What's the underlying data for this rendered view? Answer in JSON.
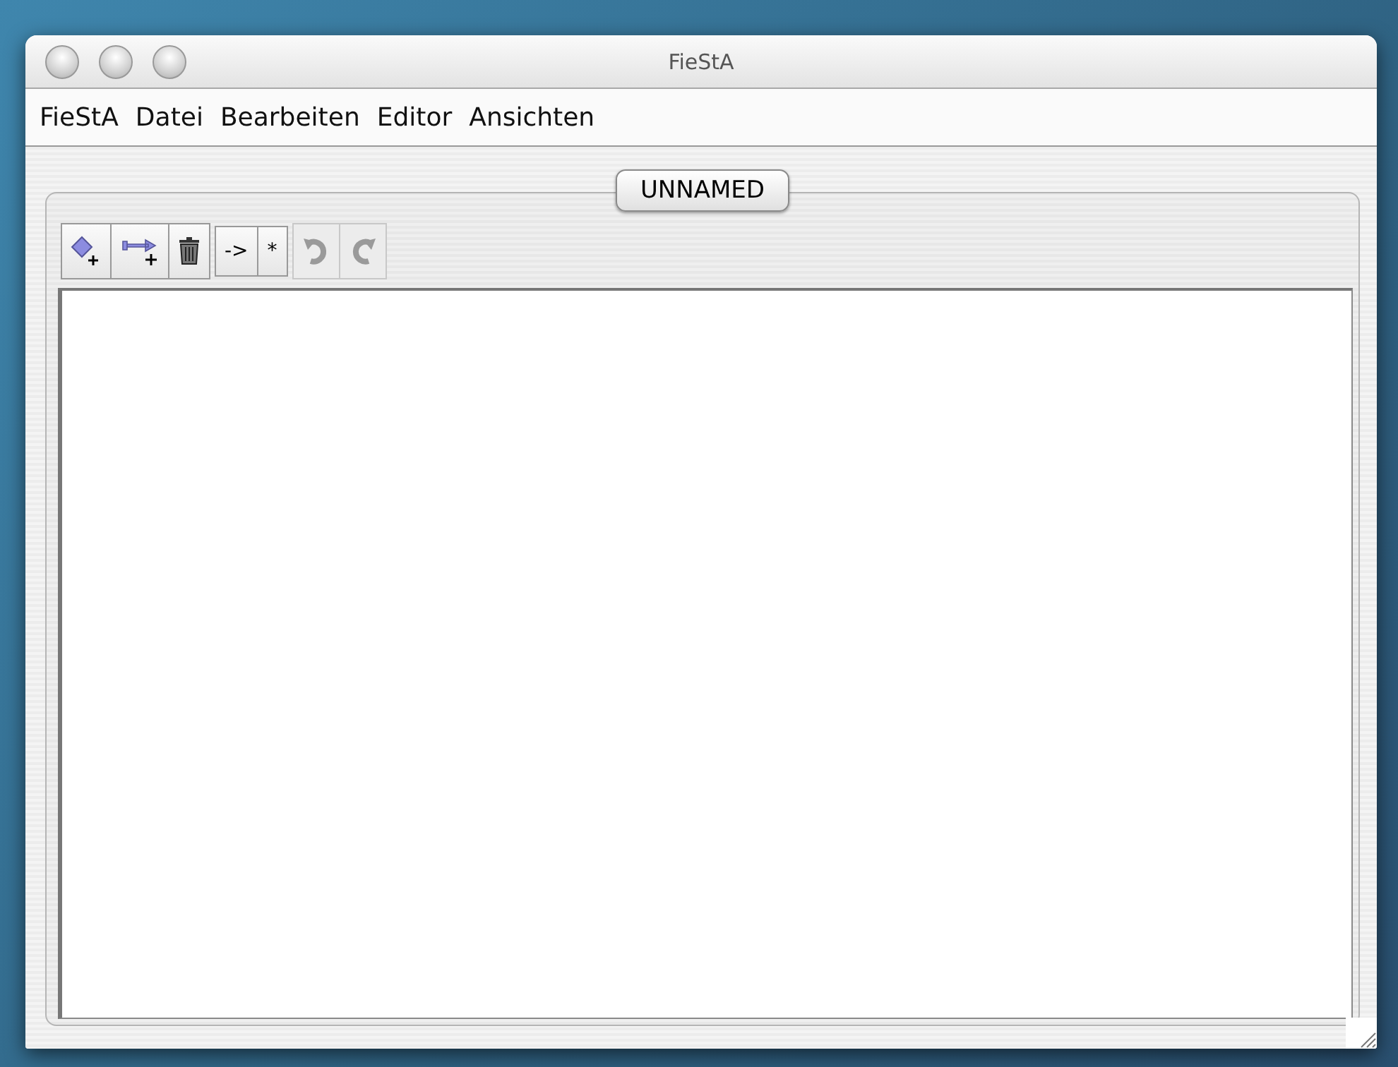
{
  "window": {
    "title": "FieStA"
  },
  "menu": [
    "FieStA",
    "Datei",
    "Bearbeiten",
    "Editor",
    "Ansichten"
  ],
  "tab": {
    "label": "UNNAMED",
    "selected": true
  },
  "toolbar": [
    {
      "kind": "add-node",
      "disabled": false
    },
    {
      "kind": "add-edge",
      "disabled": false
    },
    {
      "kind": "delete",
      "disabled": false
    },
    {
      "kind": "text",
      "label": "->",
      "disabled": false
    },
    {
      "kind": "text",
      "label": "*",
      "disabled": false
    },
    {
      "kind": "undo",
      "disabled": true
    },
    {
      "kind": "redo",
      "disabled": true
    }
  ]
}
